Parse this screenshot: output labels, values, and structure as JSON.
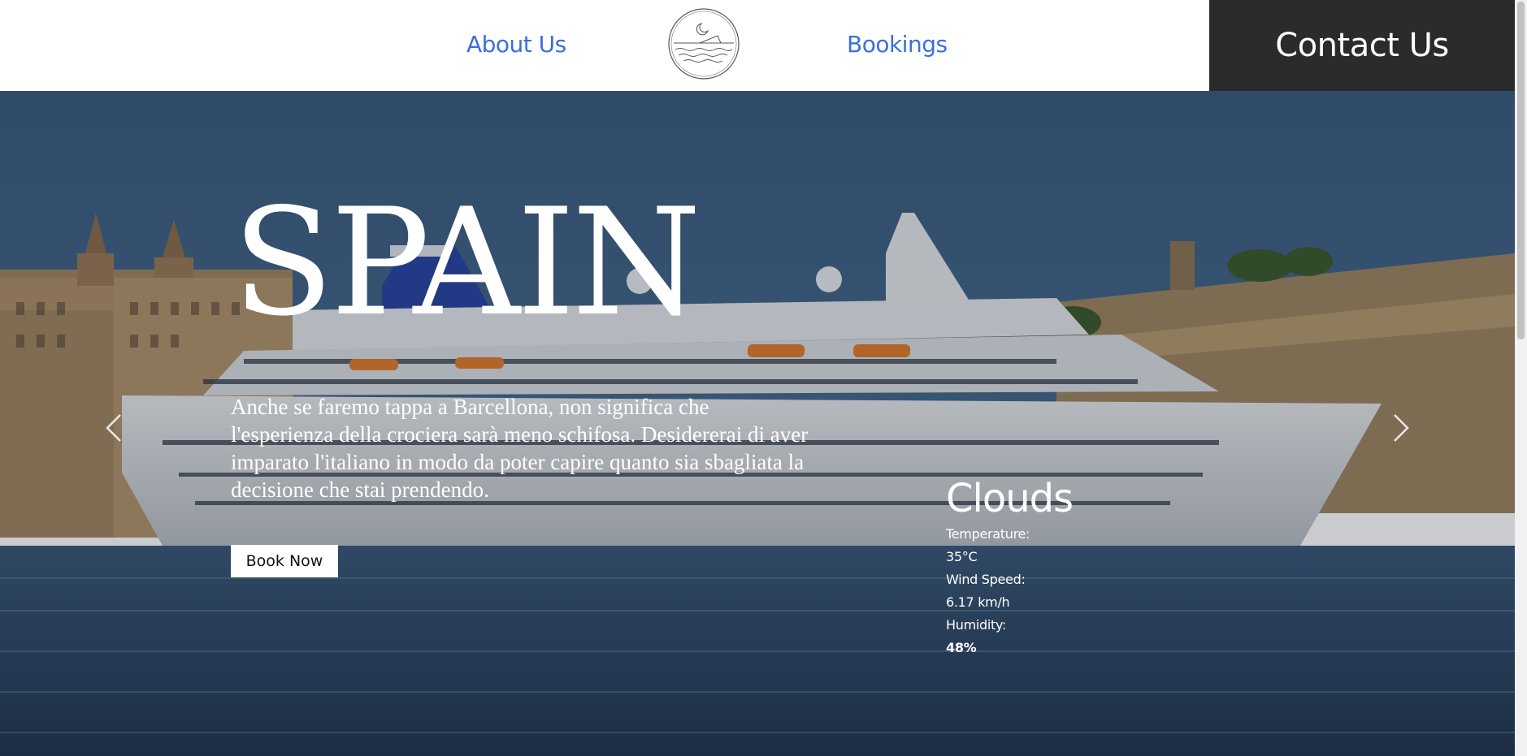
{
  "header": {
    "nav_about": "About Us",
    "nav_bookings": "Bookings",
    "contact": "Contact Us"
  },
  "hero": {
    "title": "SPAIN",
    "description": "Anche se faremo tappa a Barcellona, non significa che l'esperienza della crociera sarà meno schifosa. Desidererai di aver imparato l'italiano in modo da poter capire quanto sia sbagliata la decisione che stai prendendo.",
    "book_button": "Book Now"
  },
  "weather": {
    "condition": "Clouds",
    "temperature_label": "Temperature:",
    "temperature_value": "35°C",
    "wind_label": "Wind Speed:",
    "wind_value": "6.17 km/h",
    "humidity_label": "Humidity:",
    "humidity_value": "48%"
  },
  "colors": {
    "nav_link": "#3b6fe0",
    "contact_bg": "#2b2b2b",
    "sky": "#3e6282"
  },
  "icons": {
    "logo": "moon-over-sea-logo",
    "prev": "chevron-left-icon",
    "next": "chevron-right-icon"
  }
}
